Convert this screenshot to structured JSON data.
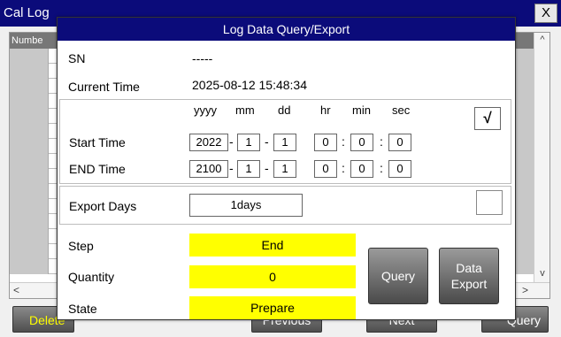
{
  "background": {
    "title": "Cal Log",
    "close_label": "X",
    "column_header": "Numbe",
    "scroll_up": "^",
    "scroll_down": "v",
    "scroll_left": "<",
    "scroll_right": ">",
    "buttons": {
      "delete": "Delete",
      "previous": "Previous",
      "next": "Next",
      "query": "Query"
    }
  },
  "dialog": {
    "title": "Log Data Query/Export",
    "sn_label": "SN",
    "sn_value": "-----",
    "current_time_label": "Current Time",
    "current_time_value": "2025-08-12 15:48:34",
    "units": {
      "yyyy": "yyyy",
      "mm": "mm",
      "dd": "dd",
      "hr": "hr",
      "min": "min",
      "sec": "sec"
    },
    "start_time": {
      "label": "Start Time",
      "yyyy": "2022",
      "mm": "1",
      "dd": "1",
      "hr": "0",
      "min": "0",
      "sec": "0"
    },
    "end_time": {
      "label": "END Time",
      "yyyy": "2100",
      "mm": "1",
      "dd": "1",
      "hr": "0",
      "min": "0",
      "sec": "0"
    },
    "time_checkbox_mark": "√",
    "date_separator": "-",
    "time_separator": ":",
    "export_days_label": "Export Days",
    "export_days_value": "1days",
    "step_label": "Step",
    "step_value": "End",
    "quantity_label": "Quantity",
    "quantity_value": "0",
    "state_label": "State",
    "state_value": "Prepare",
    "query_button": "Query",
    "data_export_button_line1": "Data",
    "data_export_button_line2": "Export"
  },
  "colors": {
    "titlebar": "#0b0b7a",
    "status_highlight": "#ffff00",
    "delete_text": "#ffff00"
  }
}
